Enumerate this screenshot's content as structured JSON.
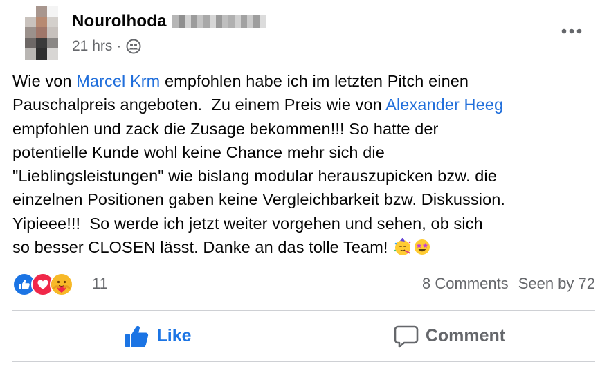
{
  "post": {
    "author_name": "Nourolhoda",
    "timestamp": "21 hrs",
    "meta_separator": "·",
    "audience_icon": "friends-icon",
    "text_segments": [
      {
        "type": "text",
        "value": "Wie von "
      },
      {
        "type": "mention",
        "value": "Marcel Krm"
      },
      {
        "type": "text",
        "value": " empfohlen habe ich im letzten Pitch einen\nPauschalpreis angeboten.  Zu einem Preis wie von "
      },
      {
        "type": "mention",
        "value": "Alexander Heeg"
      },
      {
        "type": "text",
        "value": "\nempfohlen und zack die Zusage bekommen!!! So hatte der\npotentielle Kunde wohl keine Chance mehr sich die\n\"Lieblingsleistungen\" wie bislang modular herauszupicken bzw. die\neinzelnen Positionen gaben keine Vergleichbarkeit bzw. Diskussion.\nYipieee!!!  So werde ich jetzt weiter vorgehen und sehen, ob sich\nso besser CLOSEN lässt. Danke an das tolle Team! "
      }
    ],
    "trailing_emojis": [
      "partying-face-emoji",
      "star-struck-emoji"
    ],
    "more_icon": "more-horizontal-icon"
  },
  "reactions": {
    "icons": [
      "like-reaction-icon",
      "love-reaction-icon",
      "care-reaction-icon"
    ],
    "count": "11",
    "comments": "8 Comments",
    "seen_by": "Seen by 72"
  },
  "actions": {
    "like_label": "Like",
    "like_icon": "thumbs-up-icon",
    "comment_label": "Comment",
    "comment_icon": "speech-bubble-icon"
  },
  "colors": {
    "mention": "#216fdb",
    "like_accent": "#1b74e4",
    "secondary_text": "#65676b",
    "divider": "#ced0d4"
  }
}
